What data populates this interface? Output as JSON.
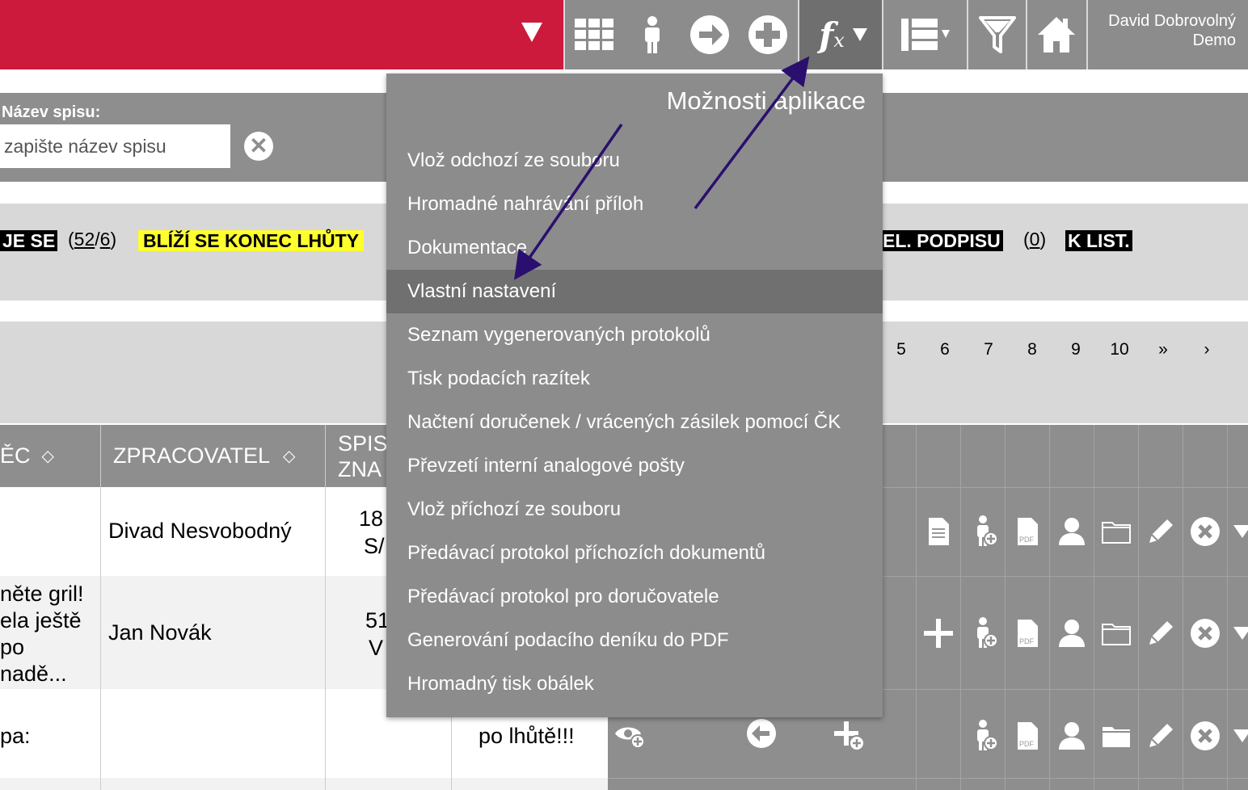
{
  "user": {
    "name": "David Dobrovolný",
    "org": "Demo"
  },
  "toolbar": {
    "icons": [
      "grid-icon",
      "person-icon",
      "arrow-right-circle-icon",
      "plus-circle-icon",
      "fx-icon",
      "numbered-list-icon",
      "filter-funnel-icon",
      "home-icon"
    ]
  },
  "filter": {
    "label": "Název spisu:",
    "placeholder": "zapište název spisu"
  },
  "badges": [
    {
      "label": "JE SE",
      "count_a": "52",
      "count_b": "6"
    },
    {
      "label": "BLÍŽÍ SE KONEC LHŮTY"
    },
    {
      "label": "EL. PODPISU",
      "count": "0"
    },
    {
      "label": "K LIST."
    }
  ],
  "pagination": [
    "5",
    "6",
    "7",
    "8",
    "9",
    "10",
    "»",
    "›"
  ],
  "table": {
    "headers": [
      "ĚC",
      "ZPRACOVATEL",
      "SPIS",
      "ZNA"
    ],
    "rows": [
      {
        "col1": "",
        "zpracovatel": "Divad Nesvobodný",
        "spis_a": "18",
        "spis_b": "S/"
      },
      {
        "col1_lines": [
          "něte gril!",
          "ela ještě",
          " po",
          "nadě..."
        ],
        "zpracovatel": "Jan Novák",
        "spis_a": "51",
        "spis_b": "V"
      },
      {
        "col1": "pa:",
        "zpracovatel": "",
        "note": "po lhůtě!!!"
      }
    ]
  },
  "menu": {
    "title": "Možnosti aplikace",
    "items": [
      "Vlož odchozí ze souboru",
      "Hromadné nahrávání příloh",
      "Dokumentace",
      "Vlastní nastavení",
      "Seznam vygenerovaných protokolů",
      "Tisk podacích razítek",
      "Načtení doručenek / vrácených zásilek pomocí ČK",
      "Převzetí interní analogové pošty",
      "Vlož příchozí ze souboru",
      "Předávací protokol příchozích dokumentů",
      "Předávací protokol pro doručovatele",
      "Generování podacího deníku do PDF",
      "Hromadný tisk obálek"
    ],
    "active_index": 3
  },
  "colors": {
    "brand_red": "#cc1a3c",
    "toolbar_grey": "#8c8c8c",
    "highlight_yellow": "#ffff2e",
    "annotation_arrow": "#2a0f6e"
  }
}
